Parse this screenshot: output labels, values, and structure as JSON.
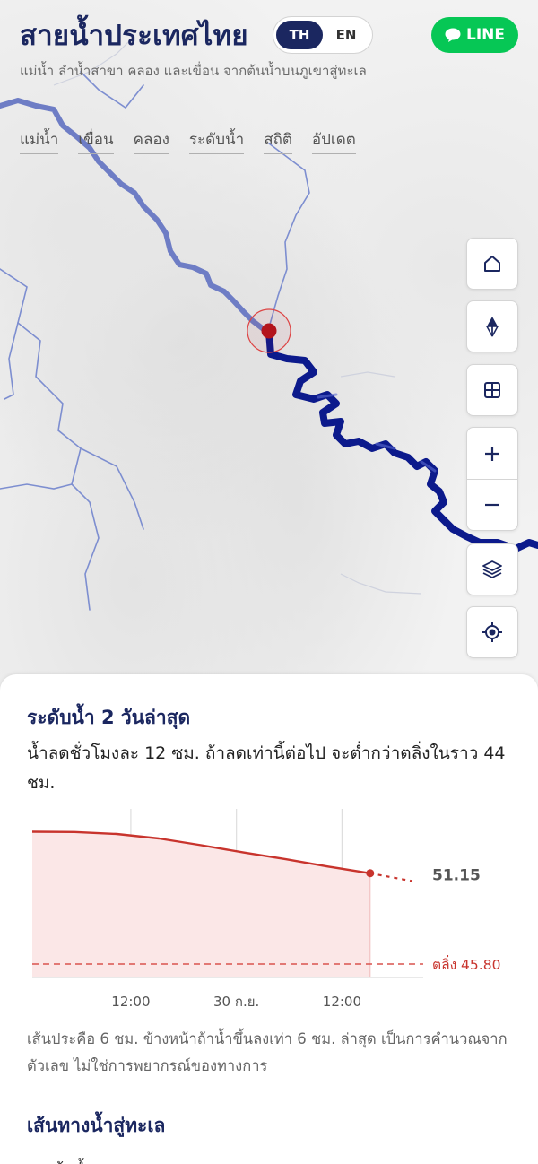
{
  "header": {
    "title": "สายน้ำประเทศไทย",
    "subtitle": "แม่น้ำ ลำน้ำสาขา คลอง และเขื่อน จากต้นน้ำบนภูเขาสู่ทะเล",
    "lang": {
      "th": "TH",
      "en": "EN",
      "active": "TH"
    },
    "line_label": "LINE",
    "nav": [
      "แม่น้ำ",
      "เขื่อน",
      "คลอง",
      "ระดับน้ำ",
      "สถิติ",
      "อัปเดต"
    ]
  },
  "map_controls": [
    "home-icon",
    "compass-icon",
    "grid-icon",
    "zoom-in-icon",
    "zoom-out-icon",
    "layers-icon",
    "locate-icon"
  ],
  "colors": {
    "brand": "#1b2760",
    "river_dark": "#0c1a8c",
    "river_light": "#6c7cc4",
    "station": "#b3141c",
    "line_green": "#06c755",
    "trend": "#c8342d"
  },
  "panel": {
    "title": "ระดับน้ำ 2 วันล่าสุด",
    "description": "น้ำลดชั่วโมงละ 12 ซม. ถ้าลดเท่านี้ต่อไป จะต่ำกว่าตลิ่งในราว 44 ชม.",
    "note": "เส้นประคือ 6 ชม. ข้างหน้าถ้าน้ำขึ้นลงเท่า 6 ชม. ล่าสุด เป็นการคำนวณจากตัวเลข ไม่ใช่การพยากรณ์ของทางการ",
    "section_title": "เส้นทางน้ำสู่ทะเล",
    "cut_text": "จากต้นน้ำ"
  },
  "chart_data": {
    "type": "area",
    "x_ticks": [
      "12:00",
      "30 ก.ย.",
      "12:00"
    ],
    "x_hours": [
      0,
      6,
      12,
      18,
      24,
      30,
      36,
      42,
      48
    ],
    "values": [
      57.6,
      57.58,
      57.4,
      57.0,
      56.4,
      55.75,
      55.15,
      54.5,
      53.9
    ],
    "forecast": {
      "x_hours": [
        48,
        54
      ],
      "values": [
        53.9,
        53.2
      ]
    },
    "last_label": "51.15",
    "bank_value": 45.8,
    "bank_label": "ตลิ่ง 45.80",
    "ylim": [
      44.6,
      59.0
    ],
    "grid": true
  }
}
